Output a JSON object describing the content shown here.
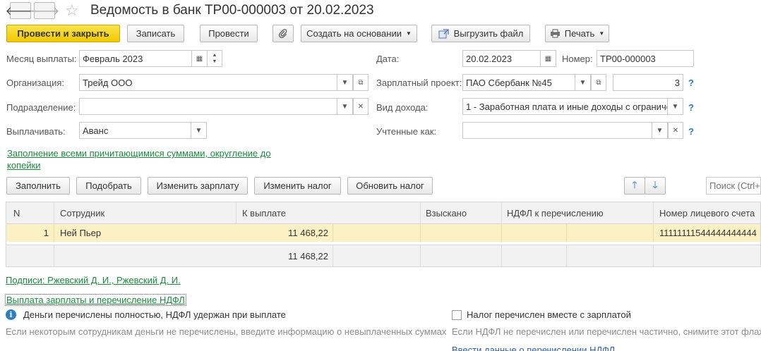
{
  "window": {
    "title": "Ведомость в банк ТР00-000003 от 20.02.2023",
    "back_glyph": "🡐",
    "forward_glyph": "🡒",
    "star_glyph": "☆"
  },
  "toolbar": {
    "post_close": "Провести и закрыть",
    "save": "Записать",
    "post": "Провести",
    "create_based": "Создать на основании",
    "export_file": "Выгрузить файл",
    "print": "Печать"
  },
  "form": {
    "pay_month_label": "Месяц выплаты:",
    "pay_month_value": "Февраль 2023",
    "date_label": "Дата:",
    "date_value": "20.02.2023",
    "number_label": "Номер:",
    "number_value": "ТР00-000003",
    "org_label": "Организация:",
    "org_value": "Трейд ООО",
    "salary_project_label": "Зарплатный проект:",
    "salary_project_value": "ПАО Сбербанк №45",
    "salary_project_number": "3",
    "division_label": "Подразделение:",
    "division_value": "",
    "income_type_label": "Вид дохода:",
    "income_type_value": "1 - Заработная плата и иные доходы с ограниче",
    "pay_label": "Выплачивать:",
    "pay_value": "Аванс",
    "counted_as_label": "Учтенные как:",
    "counted_as_value": "",
    "fill_link_line1": "Заполнение всеми причитающимися суммами, округление до",
    "fill_link_line2": "копейки",
    "help_mark": "?"
  },
  "table_toolbar": {
    "fill": "Заполнить",
    "pick": "Подобрать",
    "change_salary": "Изменить зарплату",
    "change_tax": "Изменить налог",
    "update_tax": "Обновить налог",
    "search_placeholder": "Поиск (Ctrl+F)"
  },
  "table": {
    "columns": [
      "N",
      "Сотрудник",
      "К выплате",
      "Взыскано",
      "НДФЛ к перечислению",
      "Номер лицевого счета"
    ],
    "rows": [
      {
        "n": "1",
        "employee": "Ней Пьер",
        "to_pay": "11 468,22",
        "withheld": "",
        "ndfl": "",
        "account": "11111111544444444444"
      }
    ],
    "total_to_pay": "11 468,22"
  },
  "footer": {
    "signatures": "Подписи: Ржевский Д. И., Ржевский Д. И.",
    "payout_link": "Выплата зарплаты и перечисление НДФЛ",
    "info_text": "Деньги перечислены  полностью, НДФЛ удержан при выплате",
    "checkbox_label": "Налог перечислен вместе с зарплатой",
    "hint_left": "Если некоторым сотрудникам деньги не перечислены, введите информацию о невыплаченных суммах",
    "hint_right": "Если НДФЛ не перечислен или перечислен частично, снимите этот флажок",
    "bottom_link": "Ввести данные о перечислении НДФЛ"
  }
}
